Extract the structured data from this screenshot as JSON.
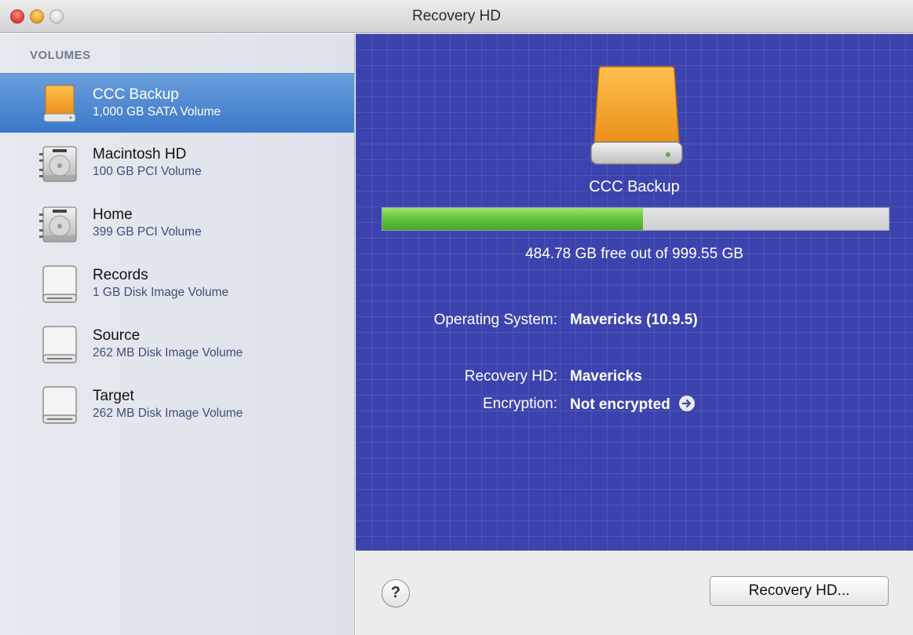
{
  "window": {
    "title": "Recovery HD"
  },
  "sidebar": {
    "header": "VOLUMES",
    "volumes": [
      {
        "name": "CCC Backup",
        "detail": "1,000 GB SATA Volume",
        "icon": "external-drive-orange-icon",
        "selected": true
      },
      {
        "name": "Macintosh HD",
        "detail": "100 GB PCI Volume",
        "icon": "internal-hard-drive-icon",
        "selected": false
      },
      {
        "name": "Home",
        "detail": "399 GB PCI Volume",
        "icon": "internal-hard-drive-icon",
        "selected": false
      },
      {
        "name": "Records",
        "detail": "1 GB Disk Image Volume",
        "icon": "disk-image-volume-icon",
        "selected": false
      },
      {
        "name": "Source",
        "detail": "262 MB Disk Image Volume",
        "icon": "disk-image-volume-icon",
        "selected": false
      },
      {
        "name": "Target",
        "detail": "262 MB Disk Image Volume",
        "icon": "disk-image-volume-icon",
        "selected": false
      }
    ]
  },
  "details": {
    "drive_name": "CCC Backup",
    "used_fraction": 0.515,
    "free_text": "484.78 GB free out of 999.55 GB",
    "os_label": "Operating System:",
    "os_value": "Mavericks (10.9.5)",
    "recovery_label": "Recovery HD:",
    "recovery_value": "Mavericks",
    "encryption_label": "Encryption:",
    "encryption_value": "Not encrypted"
  },
  "buttons": {
    "help_label": "?",
    "recovery_label": "Recovery HD..."
  },
  "colors": {
    "panel_bg": "#3c43ae",
    "selection": "#3a78c9",
    "capacity_used": "#5cbf37",
    "drive_orange": "#f0a532"
  }
}
